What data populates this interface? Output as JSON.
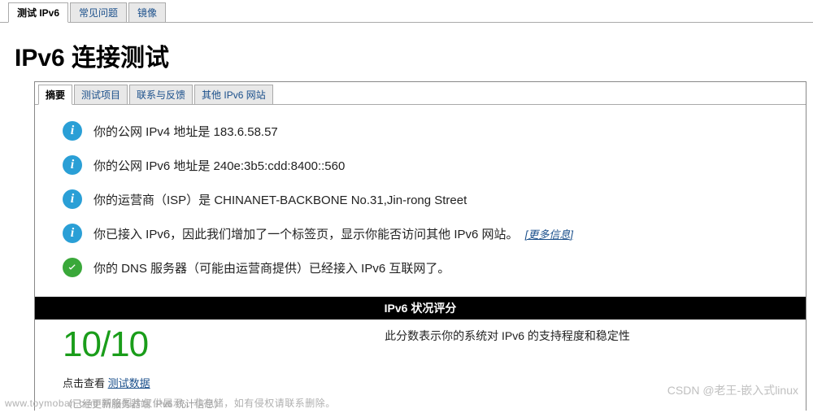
{
  "top_tabs": {
    "items": [
      {
        "label": "测试 IPv6"
      },
      {
        "label": "常见问题"
      },
      {
        "label": "镜像"
      }
    ]
  },
  "page_title": "IPv6 连接测试",
  "sub_tabs": {
    "items": [
      {
        "label": "摘要"
      },
      {
        "label": "测试项目"
      },
      {
        "label": "联系与反馈"
      },
      {
        "label": "其他 IPv6 网站"
      }
    ]
  },
  "summary": {
    "items": [
      {
        "icon": "info",
        "text": "你的公网 IPv4 地址是 183.6.58.57"
      },
      {
        "icon": "info",
        "text": "你的公网 IPv6 地址是 240e:3b5:cdd:8400::560"
      },
      {
        "icon": "info",
        "text": "你的运营商（ISP）是 CHINANET-BACKBONE No.31,Jin-rong Street"
      },
      {
        "icon": "info",
        "text": "你已接入 IPv6，因此我们增加了一个标签页，显示你能否访问其他 IPv6 网站。",
        "more": "[更多信息]"
      },
      {
        "icon": "check",
        "text": "你的 DNS 服务器（可能由运营商提供）已经接入 IPv6 互联网了。"
      }
    ]
  },
  "score": {
    "header": "IPv6 状况评分",
    "value": "10/10",
    "description": "此分数表示你的系统对 IPv6 的支持程度和稳定性"
  },
  "click_view": {
    "prefix": "点击查看 ",
    "link": "测试数据"
  },
  "stats_note": "（已经更新服务器端 IPv6 统计信息）",
  "watermark_left": "www.toymoban.com 网络图片仅供展示，非存储，如有侵权请联系删除。",
  "watermark_right": "CSDN @老王-嵌入式linux"
}
